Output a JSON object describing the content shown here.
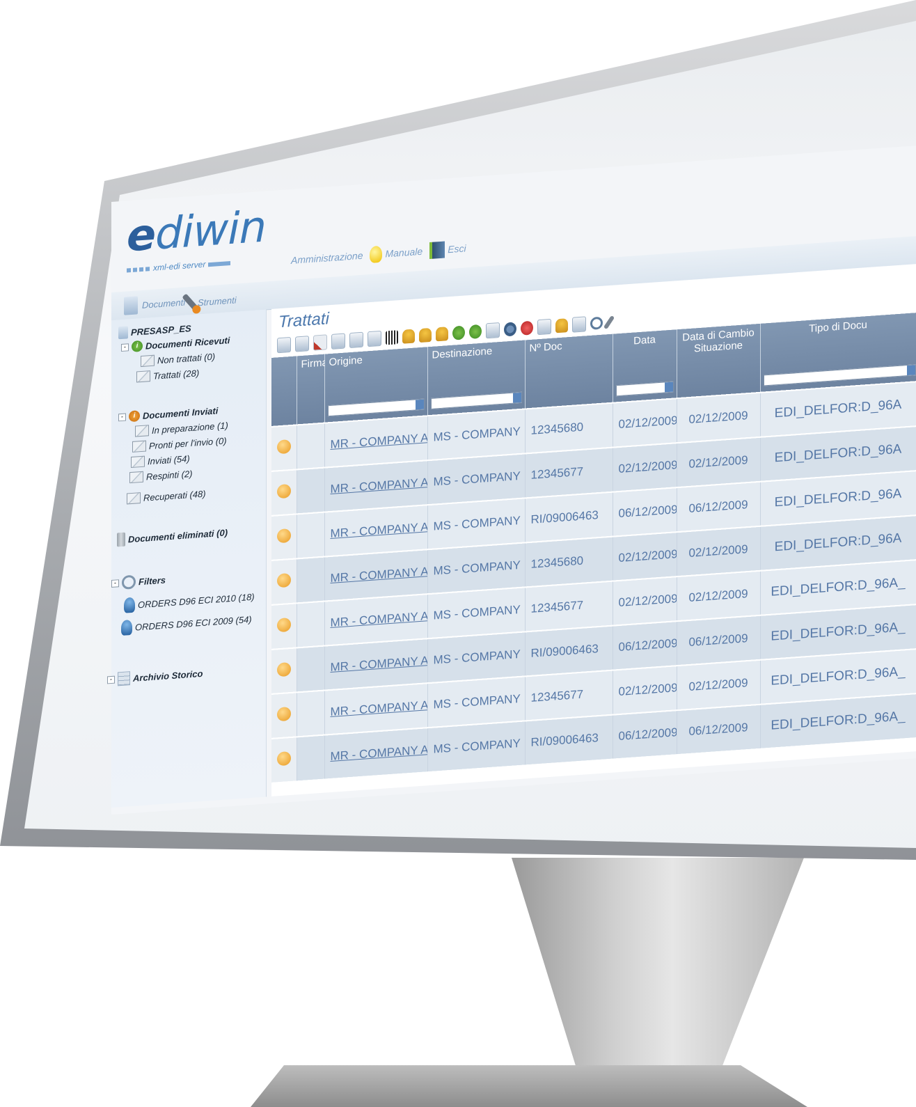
{
  "logo": {
    "name": "ediwin",
    "subtitle": "xml-edi server"
  },
  "top_menu": {
    "administration": "Amministrazione",
    "manual": "Manuale",
    "exit": "Esci"
  },
  "nav_tabs": {
    "documents": "Documenti",
    "tools": "Strumenti"
  },
  "sidebar": {
    "root": "PRESASP_ES",
    "received": {
      "label": "Documenti Ricevuti",
      "items": [
        "Non trattati (0)",
        "Trattati (28)"
      ]
    },
    "sent": {
      "label": "Documenti Inviati",
      "items": [
        "In preparazione (1)",
        "Pronti per l'invio (0)",
        "Inviati (54)",
        "Respinti (2)",
        "Recuperati (48)"
      ]
    },
    "deleted": "Documenti eliminati (0)",
    "filters": {
      "label": "Filters",
      "items": [
        "ORDERS D96 ECI 2010 (18)",
        "ORDERS D96 ECI 2009 (54)"
      ]
    },
    "archive": "Archivio Storico"
  },
  "main": {
    "title": "Trattati",
    "columns": {
      "firma": "Firma",
      "origine": "Origine",
      "destinazione": "Destinazione",
      "ndoc": "Nº Doc",
      "data": "Data",
      "data_cambio": "Data di Cambio Situazione",
      "tipo": "Tipo di Docu"
    },
    "rows": [
      {
        "origine": "MR - COMPANY A",
        "destinazione": "MS - COMPANY",
        "ndoc": "12345680",
        "data": "02/12/2009",
        "data_cambio": "02/12/2009",
        "tipo": "EDI_DELFOR:D_96A"
      },
      {
        "origine": "MR - COMPANY A",
        "destinazione": "MS - COMPANY",
        "ndoc": "12345677",
        "data": "02/12/2009",
        "data_cambio": "02/12/2009",
        "tipo": "EDI_DELFOR:D_96A"
      },
      {
        "origine": "MR - COMPANY A",
        "destinazione": "MS - COMPANY",
        "ndoc": "RI/09006463",
        "data": "06/12/2009",
        "data_cambio": "06/12/2009",
        "tipo": "EDI_DELFOR:D_96A"
      },
      {
        "origine": "MR - COMPANY A",
        "destinazione": "MS - COMPANY",
        "ndoc": "12345680",
        "data": "02/12/2009",
        "data_cambio": "02/12/2009",
        "tipo": "EDI_DELFOR:D_96A"
      },
      {
        "origine": "MR - COMPANY A",
        "destinazione": "MS - COMPANY",
        "ndoc": "12345677",
        "data": "02/12/2009",
        "data_cambio": "02/12/2009",
        "tipo": "EDI_DELFOR:D_96A_"
      },
      {
        "origine": "MR - COMPANY A",
        "destinazione": "MS - COMPANY",
        "ndoc": "RI/09006463",
        "data": "06/12/2009",
        "data_cambio": "06/12/2009",
        "tipo": "EDI_DELFOR:D_96A_"
      },
      {
        "origine": "MR - COMPANY A",
        "destinazione": "MS - COMPANY",
        "ndoc": "12345677",
        "data": "02/12/2009",
        "data_cambio": "02/12/2009",
        "tipo": "EDI_DELFOR:D_96A_"
      },
      {
        "origine": "MR - COMPANY A",
        "destinazione": "MS - COMPANY",
        "ndoc": "RI/09006463",
        "data": "06/12/2009",
        "data_cambio": "06/12/2009",
        "tipo": "EDI_DELFOR:D_96A_"
      }
    ]
  },
  "colors": {
    "accent": "#3b79b8",
    "header_bg": "#7a90ac",
    "row_text": "#5577a6",
    "status": "#e89a22"
  },
  "icons": [
    "document-icon",
    "wrench-icon",
    "bulb-icon",
    "exit-door-icon",
    "envelope-icon",
    "folder-icon",
    "trash-icon",
    "magnifier-icon",
    "person-icon",
    "cabinet-icon",
    "status-dot-icon"
  ]
}
